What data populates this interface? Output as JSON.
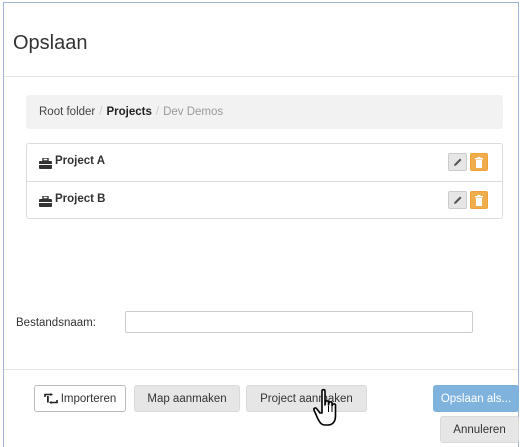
{
  "dialog": {
    "title": "Opslaan"
  },
  "breadcrumb": {
    "items": [
      {
        "label": "Root folder"
      },
      {
        "label": "Projects"
      },
      {
        "label": "Dev Demos"
      }
    ],
    "separator": "/"
  },
  "projects": [
    {
      "label": "Project A",
      "icon": "briefcase-icon"
    },
    {
      "label": "Project B",
      "icon": "briefcase-icon"
    }
  ],
  "filename": {
    "label": "Bestandsnaam:",
    "value": "",
    "placeholder": ""
  },
  "buttons": {
    "import": "Importeren",
    "new_folder": "Map aanmaken",
    "new_project": "Project aanmaken",
    "save_as": "Opslaan als...",
    "cancel": "Annuleren"
  },
  "colors": {
    "primary": "#7fb3dd",
    "warning": "#f0ad4e",
    "dialog_border": "#9fb4d2"
  }
}
